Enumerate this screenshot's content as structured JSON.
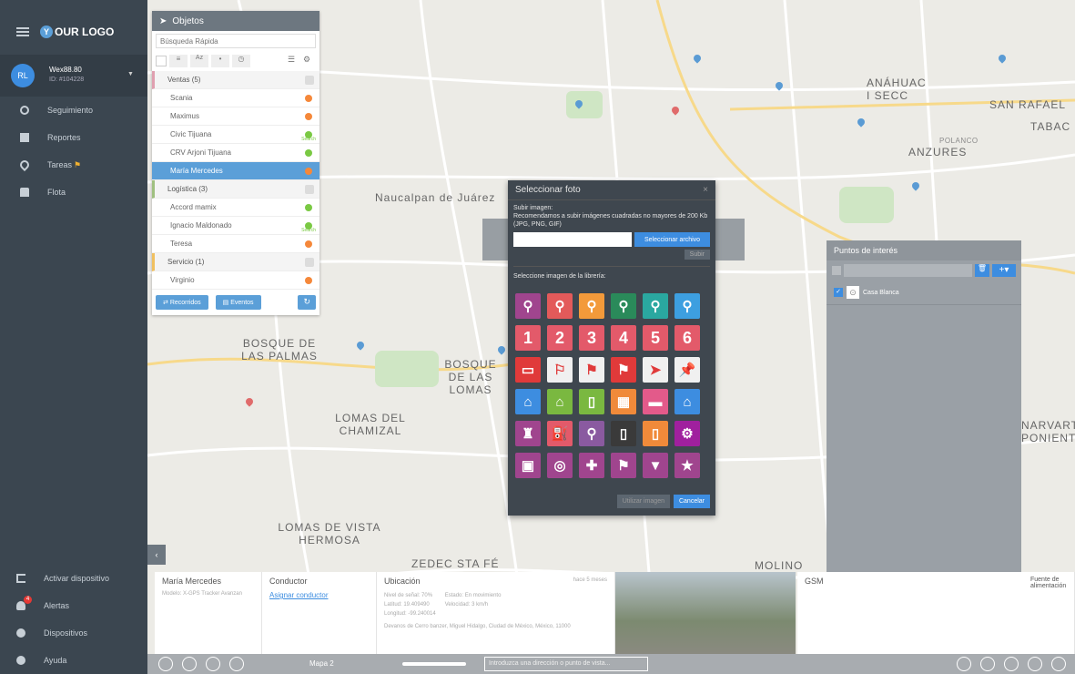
{
  "sidebar": {
    "logo": "OUR LOGO",
    "user": {
      "initials": "RL",
      "name": "Wex88.80",
      "id": "ID: #104228"
    },
    "nav": [
      {
        "label": "Seguimiento"
      },
      {
        "label": "Reportes"
      },
      {
        "label": "Tareas"
      },
      {
        "label": "Flota"
      }
    ],
    "bottom": [
      {
        "label": "Activar dispositivo"
      },
      {
        "label": "Alertas",
        "badge": "4"
      },
      {
        "label": "Dispositivos"
      },
      {
        "label": "Ayuda"
      }
    ]
  },
  "objects": {
    "title": "Objetos",
    "search_placeholder": "Búsqueda Rápida",
    "rows": [
      {
        "type": "group",
        "label": "Ventas (5)",
        "color": "#e0a0b0"
      },
      {
        "type": "item",
        "label": "Scania",
        "status": "#f5883a"
      },
      {
        "type": "item",
        "label": "Maximus",
        "status": "#f5883a"
      },
      {
        "type": "item",
        "label": "Civic Tijuana",
        "status": "#7ac943",
        "note": "Search"
      },
      {
        "type": "item",
        "label": "CRV Arjoni Tijuana",
        "status": "#7ac943"
      },
      {
        "type": "item",
        "label": "María Mercedes",
        "status": "#f5883a",
        "selected": true
      },
      {
        "type": "group",
        "label": "Logística (3)",
        "color": "#a0c080"
      },
      {
        "type": "item",
        "label": "Accord mamix",
        "status": "#7ac943"
      },
      {
        "type": "item",
        "label": "Ignacio Maldonado",
        "status": "#7ac943",
        "note": "Search"
      },
      {
        "type": "item",
        "label": "Teresa",
        "status": "#f5883a"
      },
      {
        "type": "group",
        "label": "Servicio (1)",
        "color": "#f0c060"
      },
      {
        "type": "item",
        "label": "Virginio",
        "status": "#f5883a"
      }
    ],
    "btn_recorridos": "Recorridos",
    "btn_eventos": "Eventos"
  },
  "dialog": {
    "title": "Seleccionar foto",
    "upload_heading": "Subir imagen:",
    "upload_hint": "Recomendamos a subir imágenes cuadradas no mayores de 200 Kb (JPG, PNG, GIF)",
    "select_file": "Seleccionar archivo",
    "upload_btn": "Subir",
    "library_heading": "Seleccione imagen de la librería:",
    "numbers": [
      "1",
      "2",
      "3",
      "4",
      "5",
      "6"
    ],
    "use_btn": "Utilizar imagen",
    "cancel_btn": "Cancelar"
  },
  "poi": {
    "title": "Puntos de interés",
    "item": "Casa Blanca"
  },
  "info": {
    "vehicle": "María Mercedes",
    "model": "Modelo: X-GPS Tracker Avanzan",
    "driver_title": "Conductor",
    "assign": "Asignar conductor",
    "location_title": "Ubicación",
    "signal": "Nivel de señal: 70%",
    "state": "Estado: En movimiento",
    "speed": "Velocidad: 3 km/h",
    "lat": "Latitud: 19.409490",
    "lon": "Longitud: -99.240014",
    "address": "Devanos de Cerro banzer, Miguel Hidalgo, Ciudad de México, México, 11000",
    "ago": "hace 5 meses",
    "gsm_title": "GSM",
    "fuel_title": "Fuente de alimentación"
  },
  "bottombar": {
    "map_label": "Mapa 2",
    "search_placeholder": "Introduzca una dirección o punto de vista..."
  },
  "map_labels": {
    "naucalpan": "Naucalpan de Juárez",
    "bosque": "BOSQUE DE LAS PALMAS",
    "lomas_chamizal": "LOMAS DEL CHAMIZAL",
    "lomas_vista": "LOMAS DE VISTA HERMOSA",
    "bosque_lomas": "BOSQUE DE LAS LOMAS",
    "anzures": "ANZURES",
    "anahuac": "ANÁHUAC I SECC",
    "san_rafael": "SAN RAFAEL",
    "polanco": "POLANCO",
    "zedec": "ZEDEC STA FÉ",
    "molino": "MOLINO",
    "narvarte": "NARVART PONIENT",
    "tabac": "TABAC"
  }
}
